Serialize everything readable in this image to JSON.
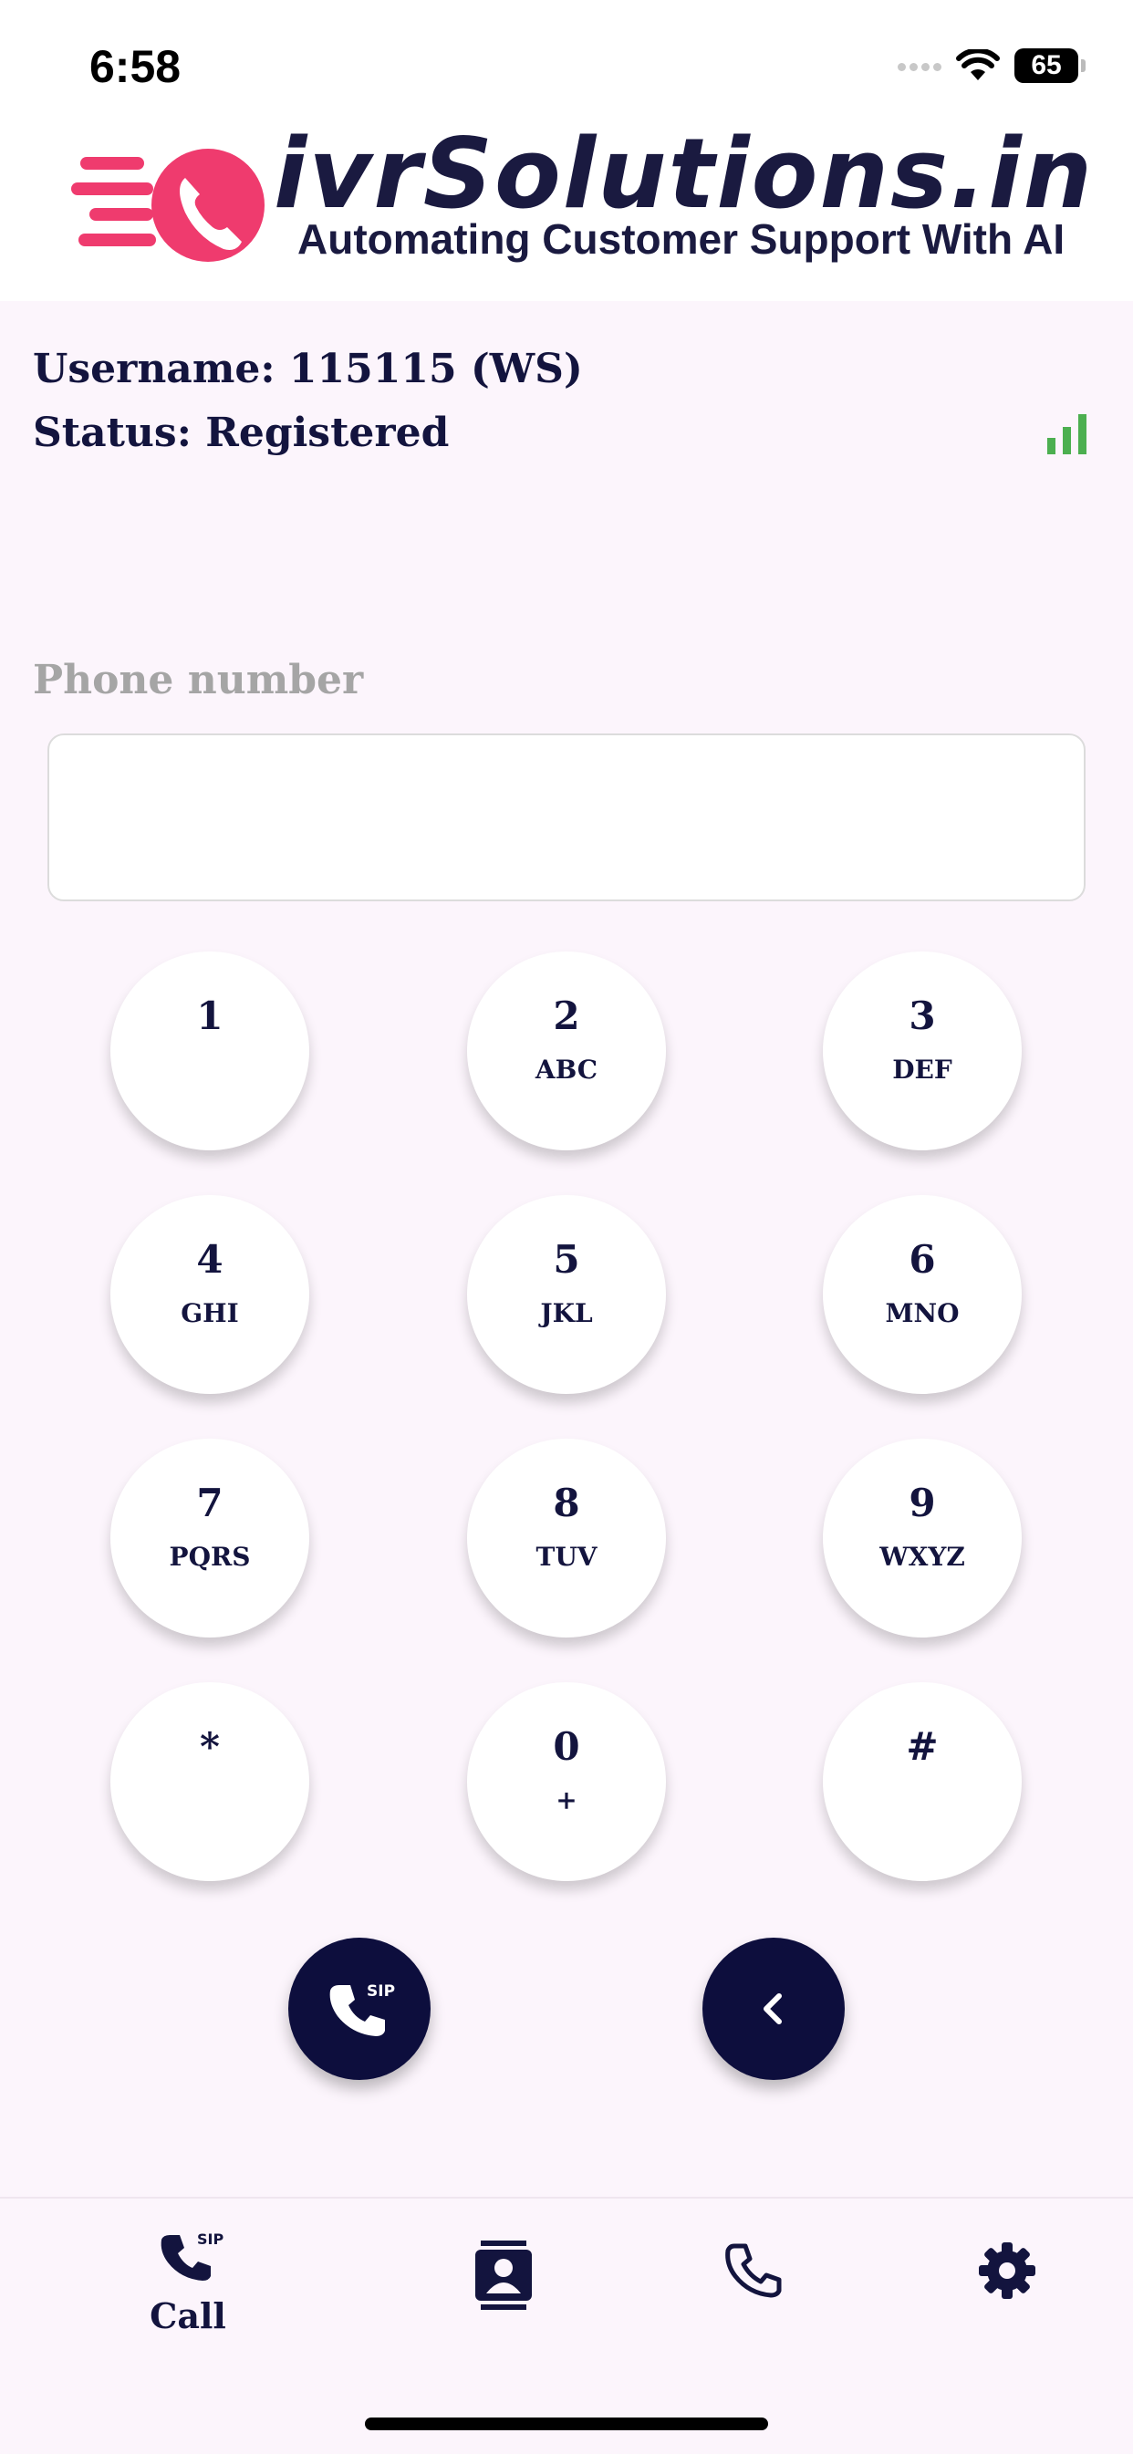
{
  "status_bar": {
    "time": "6:58",
    "battery": "65"
  },
  "header": {
    "brand": "ivrSolutions.in",
    "tagline": "Automating Customer Support With AI"
  },
  "account": {
    "username_label": "Username: 115115 (WS)",
    "status_label": "Status: Registered"
  },
  "dialer": {
    "phone_label": "Phone number",
    "phone_value": "",
    "keys": [
      {
        "digit": "1",
        "letters": ""
      },
      {
        "digit": "2",
        "letters": "ABC"
      },
      {
        "digit": "3",
        "letters": "DEF"
      },
      {
        "digit": "4",
        "letters": "GHI"
      },
      {
        "digit": "5",
        "letters": "JKL"
      },
      {
        "digit": "6",
        "letters": "MNO"
      },
      {
        "digit": "7",
        "letters": "PQRS"
      },
      {
        "digit": "8",
        "letters": "TUV"
      },
      {
        "digit": "9",
        "letters": "WXYZ"
      },
      {
        "digit": "*",
        "letters": ""
      },
      {
        "digit": "0",
        "letters": "+"
      },
      {
        "digit": "#",
        "letters": ""
      }
    ],
    "sip_badge": "SIP"
  },
  "nav": {
    "call_label": "Call",
    "sip_badge": "SIP",
    "icons": [
      "sip-call-icon",
      "contacts-icon",
      "phone-icon",
      "settings-icon"
    ]
  },
  "colors": {
    "background": "#fcf5fc",
    "primary": "#0d0e3d",
    "brand_pink": "#ef3b6e",
    "signal_green": "#4caf50"
  }
}
